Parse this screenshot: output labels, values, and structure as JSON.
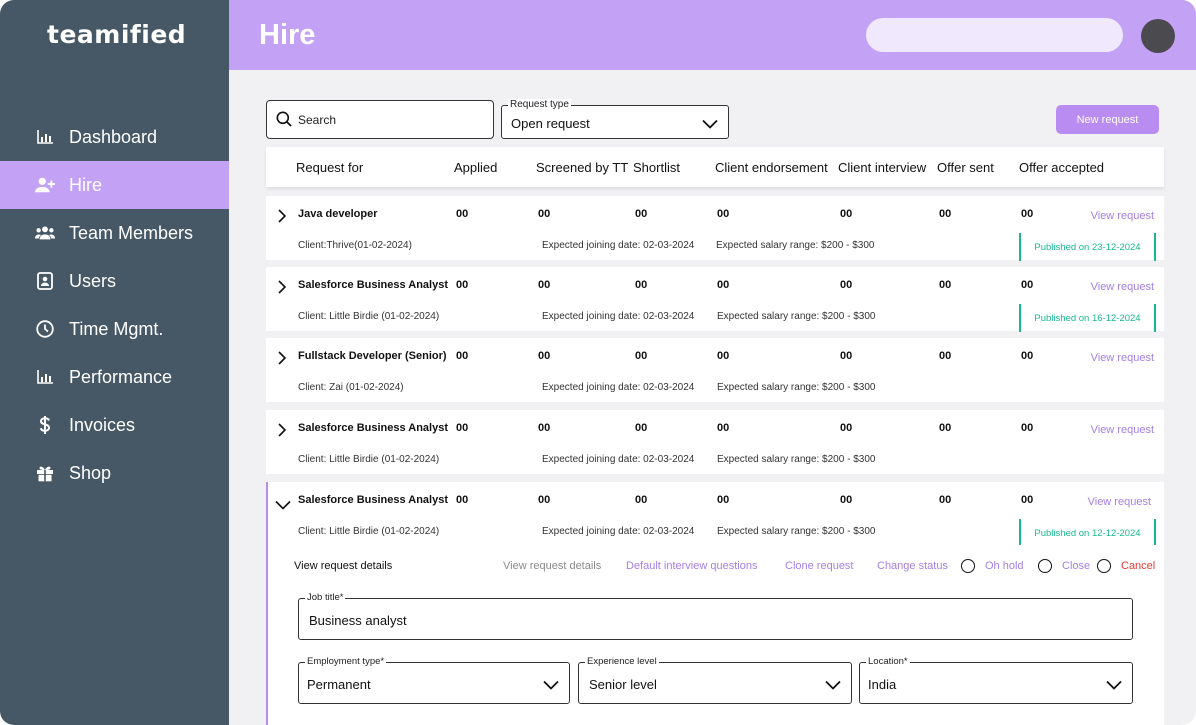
{
  "app": {
    "brand": "teamified"
  },
  "sidebar": {
    "items": [
      {
        "label": "Dashboard",
        "icon": "bar-chart-icon",
        "active": false
      },
      {
        "label": "Hire",
        "icon": "user-plus-icon",
        "active": true
      },
      {
        "label": "Team Members",
        "icon": "users-icon",
        "active": false
      },
      {
        "label": "Users",
        "icon": "contact-card-icon",
        "active": false
      },
      {
        "label": "Time Mgmt.",
        "icon": "clock-icon",
        "active": false
      },
      {
        "label": "Performance",
        "icon": "bar-chart-icon",
        "active": false
      },
      {
        "label": "Invoices",
        "icon": "dollar-icon",
        "active": false
      },
      {
        "label": "Shop",
        "icon": "gift-icon",
        "active": false
      }
    ]
  },
  "header": {
    "title": "Hire",
    "search_placeholder": ""
  },
  "toolbar": {
    "search_placeholder": "Search",
    "request_type_label": "Request type",
    "request_type_value": "Open request",
    "new_request_label": "New request"
  },
  "table": {
    "headers": [
      "Request for",
      "Applied",
      "Screened by TT",
      "Shortlist",
      "Client endorsement",
      "Client  interview",
      "Offer sent",
      "Offer accepted"
    ],
    "rows": [
      {
        "title": "Java developer",
        "values": [
          "00",
          "00",
          "00",
          "00",
          "00",
          "00",
          "00"
        ],
        "link": "View request",
        "client": "Client:Thrive(01-02-2024)",
        "joining": "Expected joining date: 02-03-2024",
        "salary": "Expected salary range: $200 - $300",
        "published": "Published on 23-12-2024",
        "expanded": false
      },
      {
        "title": "Salesforce Business Analyst",
        "values": [
          "00",
          "00",
          "00",
          "00",
          "00",
          "00",
          "00"
        ],
        "link": "View request",
        "client": "Client: Little Birdie (01-02-2024)",
        "joining": "Expected joining date: 02-03-2024",
        "salary": "Expected salary range: $200 - $300",
        "published": "Published on  16-12-2024",
        "expanded": false
      },
      {
        "title": "Fullstack Developer (Senior)",
        "values": [
          "00",
          "00",
          "00",
          "00",
          "00",
          "00",
          "00"
        ],
        "link": "View request",
        "client": "Client: Zai (01-02-2024)",
        "joining": "Expected joining date: 02-03-2024",
        "salary": "Expected salary range: $200 - $300",
        "published": "",
        "expanded": false
      },
      {
        "title": "Salesforce Business Analyst",
        "values": [
          "00",
          "00",
          "00",
          "00",
          "00",
          "00",
          "00"
        ],
        "link": "View request",
        "client": "Client: Little Birdie (01-02-2024)",
        "joining": "Expected joining date: 02-03-2024",
        "salary": "Expected salary range: $200 - $300",
        "published": "",
        "expanded": false
      },
      {
        "title": "Salesforce Business Analyst",
        "values": [
          "00",
          "00",
          "00",
          "00",
          "00",
          "00",
          "00"
        ],
        "link": "View request",
        "client": "Client: Little Birdie (01-02-2024)",
        "joining": "Expected joining date: 02-03-2024",
        "salary": "Expected salary range: $200 - $300",
        "published": "Published on 12-12-2024",
        "expanded": true
      }
    ]
  },
  "details": {
    "heading": "View request details",
    "actions": {
      "view": "View request details",
      "default_questions": "Default interview questions",
      "clone": "Clone request",
      "change_status": "Change status",
      "on_hold": "Oh hold",
      "close": "Close",
      "cancel": "Cancel"
    },
    "fields": {
      "job_title_label": "Job title*",
      "job_title_value": "Business analyst",
      "employment_type_label": "Employment type*",
      "employment_type_value": "Permanent",
      "experience_label": "Experience  level",
      "experience_value": "Senior level",
      "location_label": "Location*",
      "location_value": "India"
    }
  },
  "colors": {
    "sidebar_bg": "#465866",
    "accent": "#c3a1f5",
    "button": "#b98cf1",
    "link": "#a580e6",
    "published": "#17b890",
    "cancel": "#e53935"
  }
}
